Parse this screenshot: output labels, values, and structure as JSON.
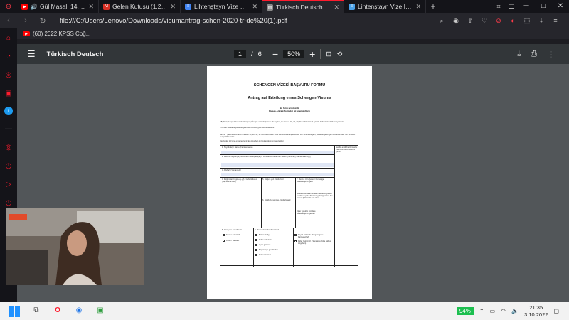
{
  "tabs": [
    {
      "title": "Gül Masalı 14. Bölüm @",
      "icon": "youtube-icon",
      "color": "#ff0000",
      "sound": true
    },
    {
      "title": "Gelen Kutusu (1.207) - doa",
      "icon": "mail-icon",
      "color": "#d93025"
    },
    {
      "title": "Lihtenştayn Vize Başvuru F",
      "icon": "doc-icon",
      "color": "#4285f4"
    },
    {
      "title": "Türkisch Deutsch",
      "icon": "pdf-icon",
      "color": "#888",
      "active": true
    },
    {
      "title": "Lihtenştayn Vize İşlemleri",
      "icon": "doc-icon",
      "color": "#4aa0e6"
    }
  ],
  "address": {
    "url": "file:///C:/Users/Lenovo/Downloads/visumantrag-schen-2020-tr-de%20(1).pdf"
  },
  "bookmark": {
    "label": "(60) 2022 KPSS Coğ..."
  },
  "pdf": {
    "title": "Türkisch Deutsch",
    "page_current": "1",
    "page_sep": "/",
    "page_total": "6",
    "zoom": "50%",
    "doc_h1": "SCHENGEN VİZESİ BAŞVURU FORMU",
    "doc_h2": "Antrag auf Erteilung eines Schengen-Visums",
    "doc_sub1": "Bu form ücretsizdir",
    "doc_sub2": "Dieses Antragsformular ist unentgeltlich",
    "para1": "AB, AEA (Avrupa Ekonomik Alanı) veya İsviçre vatandaşlarının aile üyeleri, bu formun 21, 22, 30, 31 ve 32 sayılı (* işaretli) bölümlerini doldurmayacaktır.",
    "para2": "1-3 no'lu sorular seyahat belgesindeki verilere göre doldurulacaktır.",
    "para3": "Bei mit * gekennzeichneten Feldern 21, 22, 30, 31 und 32 müssen nicht von Familienangehörigen von Unionsbürgern, Staatsangehörigen des EWR oder der Schweiz ausgefüllt werden.",
    "para4": "Die Felder 1-3 sind entsprechend den Angaben im Reisedokument auszufüllen.",
    "f1": "1. Soyadı(lar) / Name (Familienname)",
    "f2": "2. Mekanik soyadı(lar) veya ölesi adı soyadı(lar)ı / Familienname bei der Geburt (frühere(r) Familienname(n))",
    "f3": "3. Adı(lar) / Vorname(n)",
    "f4": "4. Doğum tarihi (gün-ay-yıl) / Geburtsdatum (Tag-Monat-Jahr)",
    "f5": "5. Doğum yeri / Geburtsort",
    "f6": "6. Doğduğunuz ülke / Geburtsland",
    "f7": "7. Mevcut Uyruğunuz / Derzeitige Staatsangehörigkeit",
    "f7b": "Şimdikinden farklı olması halinde doğumda belirtilen uyruk / Staatsangehörigkeit bei der Geburt (falls nicht wie oben)",
    "f7c": "Diğer uyruklar / Andere Staatsangehörigkeiten",
    "f8": "8. Cinsiyeti / Geschlecht",
    "f8a": "Erkek / männlich",
    "f8b": "Kadın / weiblich",
    "f9": "9. Medeni hal / Familienstand",
    "f9a": "Bekar / ledig",
    "f9b": "Evli / verheiratet",
    "f9c": "Ayrı / getrennt",
    "f9d": "Boşanmış / geschieden",
    "f9e": "Dul / verwitwet",
    "f9f": "Kayıtlı birliktelik / Eingetragene Partnerschaft",
    "f9g": "Diğer (belirtiniz) / Sonstiges (bitte nähere Angaben)",
    "right_col": "Nur für amtliche Vermerke / Yalnızca resmi kullanım içindir"
  },
  "taskbar": {
    "battery": "94%",
    "time": "21:35",
    "date": "3.10.2022"
  }
}
